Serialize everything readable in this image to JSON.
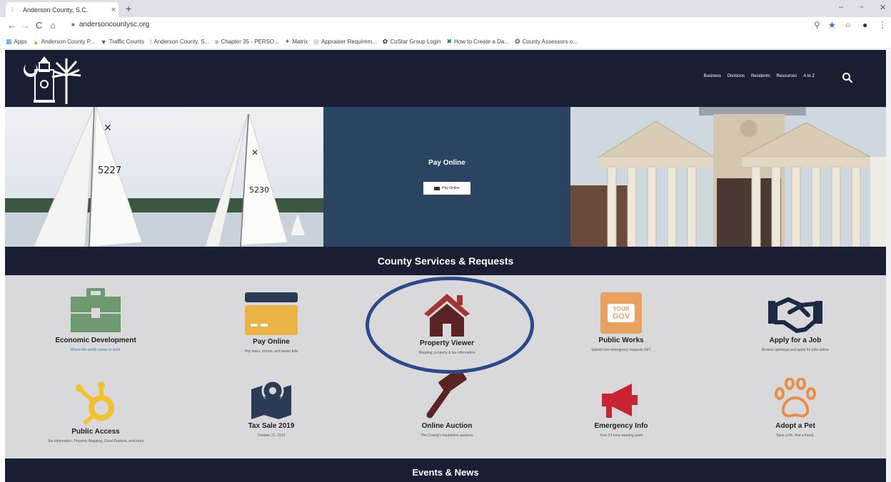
{
  "browser": {
    "tab_title": "Anderson County, S.C.",
    "tab_close": "×",
    "new_tab": "+",
    "url": "andersoncountysc.org",
    "back": "←",
    "forward": "→",
    "reload": "C",
    "home": "⌂",
    "win_min": "–",
    "win_max": "▫",
    "win_close": "✕",
    "bookmarks": [
      {
        "label": "Apps",
        "icon": "apps-grid-icon",
        "glyph": "▦"
      },
      {
        "label": "Anderson County P...",
        "icon": "person-icon",
        "glyph": "▲"
      },
      {
        "label": "Traffic Counts",
        "icon": "traffic-icon",
        "glyph": "▼"
      },
      {
        "label": "Anderson County, S...",
        "icon": "county-icon",
        "glyph": "⁞"
      },
      {
        "label": "Chapter 35 - PERSO...",
        "icon": "chapter-icon",
        "glyph": "≡"
      },
      {
        "label": "Matrix",
        "icon": "matrix-icon",
        "glyph": "✦"
      },
      {
        "label": "Appraiser Requirem...",
        "icon": "appraiser-icon",
        "glyph": "◎"
      },
      {
        "label": "CoStar Group Login",
        "icon": "costar-icon",
        "glyph": "✿"
      },
      {
        "label": "How to Create a Da...",
        "icon": "excel-icon",
        "glyph": "✖"
      },
      {
        "label": "County Assessors o...",
        "icon": "globe-icon",
        "glyph": "❂"
      }
    ]
  },
  "header": {
    "nav": [
      "Business",
      "Divisions",
      "Residents",
      "Resources",
      "A to Z"
    ]
  },
  "hero": {
    "pay_title": "Pay Online",
    "pay_button": "Pay Online",
    "sail1": "5227",
    "sail2": "5230"
  },
  "services": {
    "title": "County Services & Requests",
    "items": [
      {
        "title": "Economic Development",
        "sub": "Where the world comes to work.",
        "icon": "briefcase-icon"
      },
      {
        "title": "Pay Online",
        "sub": "Pay taxes, tickets, and sewer bills",
        "icon": "credit-card-icon"
      },
      {
        "title": "Property Viewer",
        "sub": "Mapping, property & tax information",
        "icon": "house-icon"
      },
      {
        "title": "Public Works",
        "sub": "Submit non-emergency requests 24/7",
        "icon": "your-gov-icon",
        "badge": [
          "YOUR",
          "GOV"
        ]
      },
      {
        "title": "Apply for a Job",
        "sub": "Browse openings and apply for jobs online",
        "icon": "handshake-icon"
      },
      {
        "title": "Public Access",
        "sub": "Tax Information, Property Mapping, Court Dockets, and more",
        "icon": "hubspot-icon"
      },
      {
        "title": "Tax Sale 2019",
        "sub": "October 21, 2019",
        "icon": "map-pin-icon"
      },
      {
        "title": "Online Auction",
        "sub": "The County's liquidation auctions",
        "icon": "gavel-icon"
      },
      {
        "title": "Emergency Info",
        "sub": "Your 24-hour warning point",
        "icon": "megaphone-icon"
      },
      {
        "title": "Adopt a Pet",
        "sub": "Save a life, find a friend.",
        "icon": "paw-icon"
      }
    ]
  },
  "events": {
    "title": "Events & News"
  },
  "colors": {
    "nav_bg": "#1a1e32",
    "pay_bg": "#2a4461",
    "services_bg": "#d9d9db",
    "briefcase": "#6f9a71",
    "card": "#e9b445",
    "house": "#5b2424",
    "yourgov": "#e9a15f",
    "handshake": "#1d2a44",
    "hubspot": "#f2c12e",
    "map": "#2b3a55",
    "gavel": "#5b2424",
    "megaphone": "#c7252f",
    "paw": "#e89048",
    "annotation": "#2a4a8a"
  }
}
